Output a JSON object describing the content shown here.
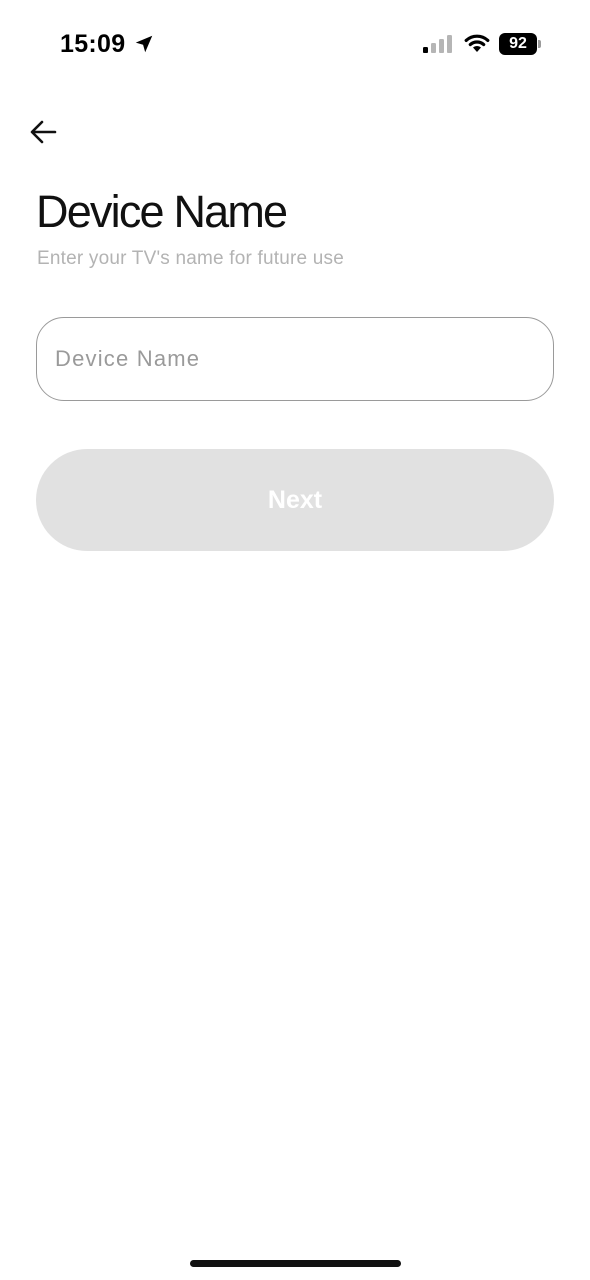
{
  "status_bar": {
    "time": "15:09",
    "battery_level": "92",
    "signal_bars_active": 1,
    "signal_bars_total": 4
  },
  "header": {
    "back_icon": "arrow-left-icon"
  },
  "main": {
    "title": "Device Name",
    "subtitle": "Enter your TV's name for future use",
    "device_name_input": {
      "value": "",
      "placeholder": "Device Name"
    },
    "next_button_label": "Next",
    "next_button_enabled": false
  },
  "colors": {
    "background": "#ffffff",
    "title": "#111111",
    "subtitle": "#b3b3b3",
    "input_border": "#9a9a9a",
    "button_disabled_bg": "#e1e1e1",
    "button_text": "#ffffff"
  }
}
